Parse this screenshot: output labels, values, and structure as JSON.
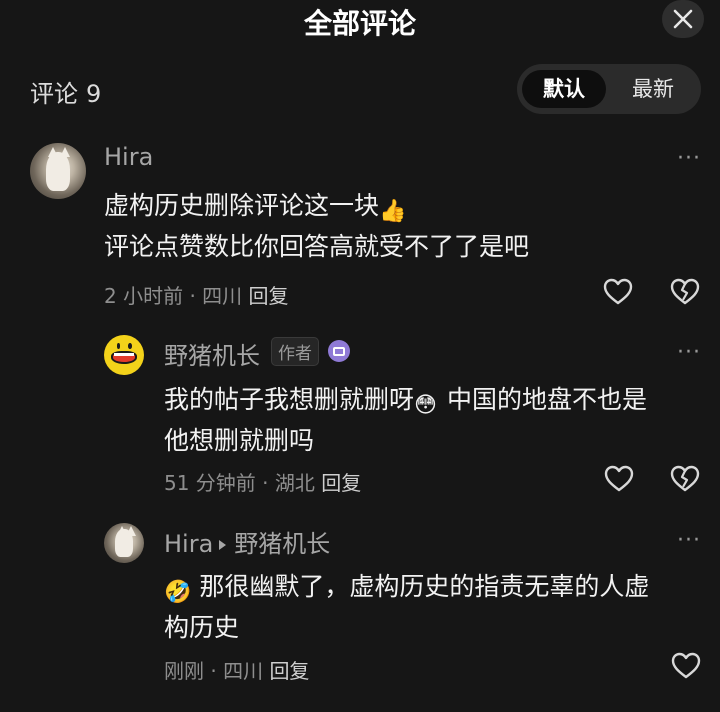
{
  "header": {
    "title": "全部评论"
  },
  "comment_bar": {
    "label": "评论",
    "count": "9"
  },
  "sort": {
    "options": [
      "默认",
      "最新"
    ],
    "selected": "默认"
  },
  "comments": [
    {
      "username": "Hira",
      "lines": [
        "虚构历史删除评论这一块",
        "评论点赞数比你回答高就受不了了是吧"
      ],
      "emoji": "thumbs-up",
      "time": "2 小时前",
      "location": "四川",
      "reply_label": "回复"
    },
    {
      "username": "野猪机长",
      "author_tag": "作者",
      "lines": [
        "我的帖子我想删就删呀",
        "中国的地盘不也是",
        "他想删就删吗"
      ],
      "emoji": "flushed-face",
      "time": "51 分钟前",
      "location": "湖北",
      "reply_label": "回复"
    },
    {
      "username": "Hira",
      "reply_to": "野猪机长",
      "lines": [
        "那很幽默了，虚构历史的指责无辜的人虚",
        "构历史"
      ],
      "emoji": "rolling-laughing-face",
      "time": "刚刚",
      "location": "四川",
      "reply_label": "回复"
    }
  ],
  "meta_separator": "·",
  "more_glyph": "···",
  "colors": {
    "background": "#161616",
    "text": "#f2f2f2",
    "muted": "#8e8e8e",
    "badge": "#8f7ad6"
  }
}
